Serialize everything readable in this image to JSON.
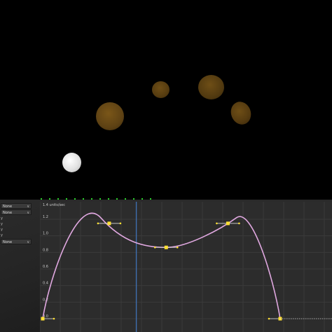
{
  "viewport": {
    "balls": [
      {
        "id": "ball-white",
        "color": "#e6e6e6"
      },
      {
        "id": "ball-brown-1",
        "color": "#6a4a14"
      },
      {
        "id": "ball-brown-2",
        "color": "#5e4214"
      },
      {
        "id": "ball-brown-3",
        "color": "#5c4010"
      },
      {
        "id": "ball-brown-4",
        "color": "#5a3e10"
      }
    ]
  },
  "left_panel": {
    "dropdown_1": "None",
    "dropdown_2": "None",
    "row_labels": [
      "y",
      "y",
      "y",
      "y"
    ],
    "dropdown_3": "None"
  },
  "graph": {
    "unit_label": "1.4 units/sec",
    "y_ticks": [
      "1.2",
      "1.0",
      "0.8",
      "0.6",
      "0.4",
      "0.2",
      "0.0"
    ],
    "curve_color": "#e0a8e0",
    "key_color": "#ffe033",
    "playhead_color": "#3f6fb0",
    "playhead_position": 0.33,
    "keyframes": [
      {
        "t": 0.0,
        "v": 0.0
      },
      {
        "t": 0.28,
        "v": 1.15
      },
      {
        "t": 0.52,
        "v": 0.86
      },
      {
        "t": 0.78,
        "v": 1.15
      },
      {
        "t": 1.0,
        "v": 0.0
      }
    ]
  }
}
